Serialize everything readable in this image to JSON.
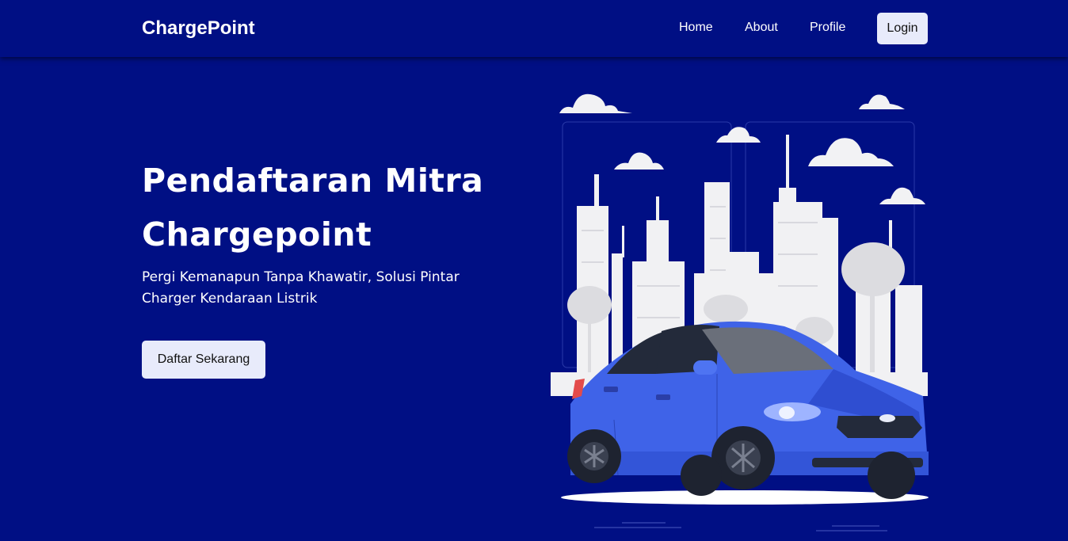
{
  "navbar": {
    "brand": "ChargePoint",
    "links": [
      "Home",
      "About",
      "Profile"
    ],
    "login_label": "Login"
  },
  "hero": {
    "title": "Pendaftaran Mitra Chargepoint",
    "subtitle": "Pergi Kemanapun Tanpa Khawatir, Solusi Pintar Charger Kendaraan Listrik",
    "cta_label": "Daftar Sekarang",
    "illustration": "city-electric-car-illustration"
  },
  "colors": {
    "background": "#000f84",
    "button_bg": "#e8ebfb",
    "car_body": "#3f63e8",
    "city": "#f1f1f3"
  }
}
